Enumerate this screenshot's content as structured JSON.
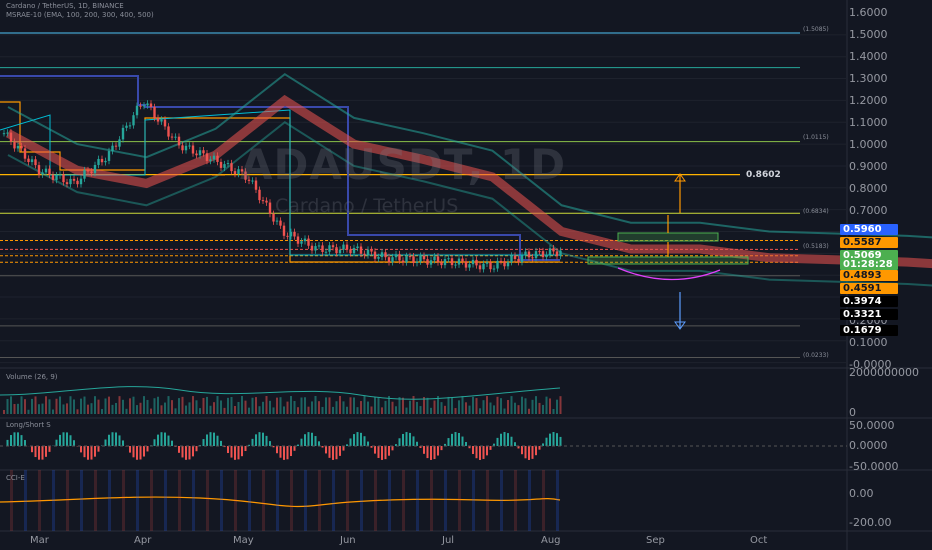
{
  "header": {
    "line1": "Cardano / TetherUS, 1D, BINANCE",
    "line2": "MSRAE-10 (EMA, 100, 200, 300, 400, 500)"
  },
  "watermark": {
    "symbol": "ADAUSDT, 1D",
    "name": "Cardano / TetherUS"
  },
  "fib_labels": [
    "(1.5085)",
    "(1.0115)",
    "(0.6834)",
    "(0.5183)",
    "(0.0233)"
  ],
  "annotation": {
    "target": "0.8602"
  },
  "price_labels": [
    {
      "text": "0.5960",
      "bg": "#2962ff",
      "fg": "#ffffff"
    },
    {
      "text": "0.5587",
      "bg": "#ff9800",
      "fg": "#131722"
    },
    {
      "text": "0.5069",
      "bg": "#4caf50",
      "fg": "#ffffff"
    },
    {
      "text": "01:28:28",
      "bg": "#4caf50",
      "fg": "#ffffff"
    },
    {
      "text": "0.4893",
      "bg": "#ff9800",
      "fg": "#131722"
    },
    {
      "text": "0.4591",
      "bg": "#ff9800",
      "fg": "#131722"
    },
    {
      "text": "0.3974",
      "bg": "#000000",
      "fg": "#ffffff"
    },
    {
      "text": "0.3321",
      "bg": "#000000",
      "fg": "#ffffff"
    },
    {
      "text": "0.1679",
      "bg": "#000000",
      "fg": "#ffffff"
    }
  ],
  "indicators": {
    "volume_title": "Volume (26, 9)",
    "longshort_title": "Long/Short S",
    "cci_title": "CCI-E"
  },
  "chart_data": {
    "type": "line",
    "title": "",
    "price_axis": {
      "ticks": [
        "1.6000",
        "1.5000",
        "1.4000",
        "1.3000",
        "1.2000",
        "1.1000",
        "1.0000",
        "0.9000",
        "0.8000",
        "0.7000",
        "0.2000",
        "0.1000",
        "-0.0000"
      ],
      "ylim": [
        0,
        1.6
      ]
    },
    "volume_axis": {
      "ticks": [
        "2000000000",
        "0"
      ]
    },
    "longshort_axis": {
      "ticks": [
        "50.0000",
        "0.0000",
        "-50.0000"
      ]
    },
    "cci_axis": {
      "ticks": [
        "0.00",
        "-200.00"
      ]
    },
    "x_ticks": [
      "Mar",
      "Apr",
      "May",
      "Jun",
      "Jul",
      "Aug",
      "Sep",
      "Oct"
    ],
    "series": [
      {
        "color": "#ef5350",
        "x": [
          "Feb 20",
          "Mar 1",
          "Mar 10",
          "Mar 20",
          "Apr 1",
          "Apr 10",
          "Apr 20",
          "May 1",
          "May 10",
          "May 20",
          "Jun 1",
          "Jun 10",
          "Jun 20",
          "Jul 1",
          "Jul 10",
          "Jul 20",
          "Aug 1"
        ],
        "values": [
          1.05,
          0.88,
          0.82,
          0.95,
          1.2,
          1.0,
          0.93,
          0.85,
          0.6,
          0.52,
          0.52,
          0.48,
          0.47,
          0.46,
          0.44,
          0.49,
          0.51
        ]
      }
    ],
    "levels": [
      1.5085,
      1.0115,
      0.8602,
      0.6834,
      0.596,
      0.5587,
      0.5183,
      0.5069,
      0.4893,
      0.4591,
      0.3974,
      0.3321,
      0.1679,
      0.0233
    ]
  }
}
